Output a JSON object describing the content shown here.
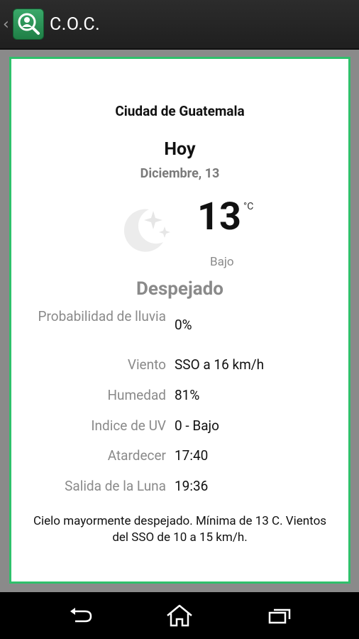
{
  "app": {
    "title": "C.O.C.",
    "up_icon": "chevron-left-icon",
    "logo_icon": "search-person-icon"
  },
  "weather": {
    "city": "Ciudad de Guatemala",
    "day": "Hoy",
    "date": "Diciembre, 13",
    "condition_icon": "moon-stars-icon",
    "temperature": "13",
    "unit": "°C",
    "level": "Bajo",
    "condition": "Despejado",
    "details": [
      {
        "label": "Probabilidad de lluvia",
        "value": "0%"
      },
      {
        "label": "Viento",
        "value": "SSO a 16 km/h"
      },
      {
        "label": "Humedad",
        "value": "81%"
      },
      {
        "label": "Indice de UV",
        "value": "0 - Bajo"
      },
      {
        "label": "Atardecer",
        "value": "17:40"
      },
      {
        "label": "Salida de la Luna",
        "value": "19:36"
      }
    ],
    "summary": "Cielo mayormente despejado. Mínima de 13 C. Vientos del SSO de 10 a 15 km/h."
  },
  "navbar": {
    "back_icon": "back-icon",
    "home_icon": "home-icon",
    "recents_icon": "recent-apps-icon"
  },
  "colors": {
    "accent": "#2fc06b",
    "actionbar": "#252525",
    "muted_text": "#8a8a8a"
  }
}
